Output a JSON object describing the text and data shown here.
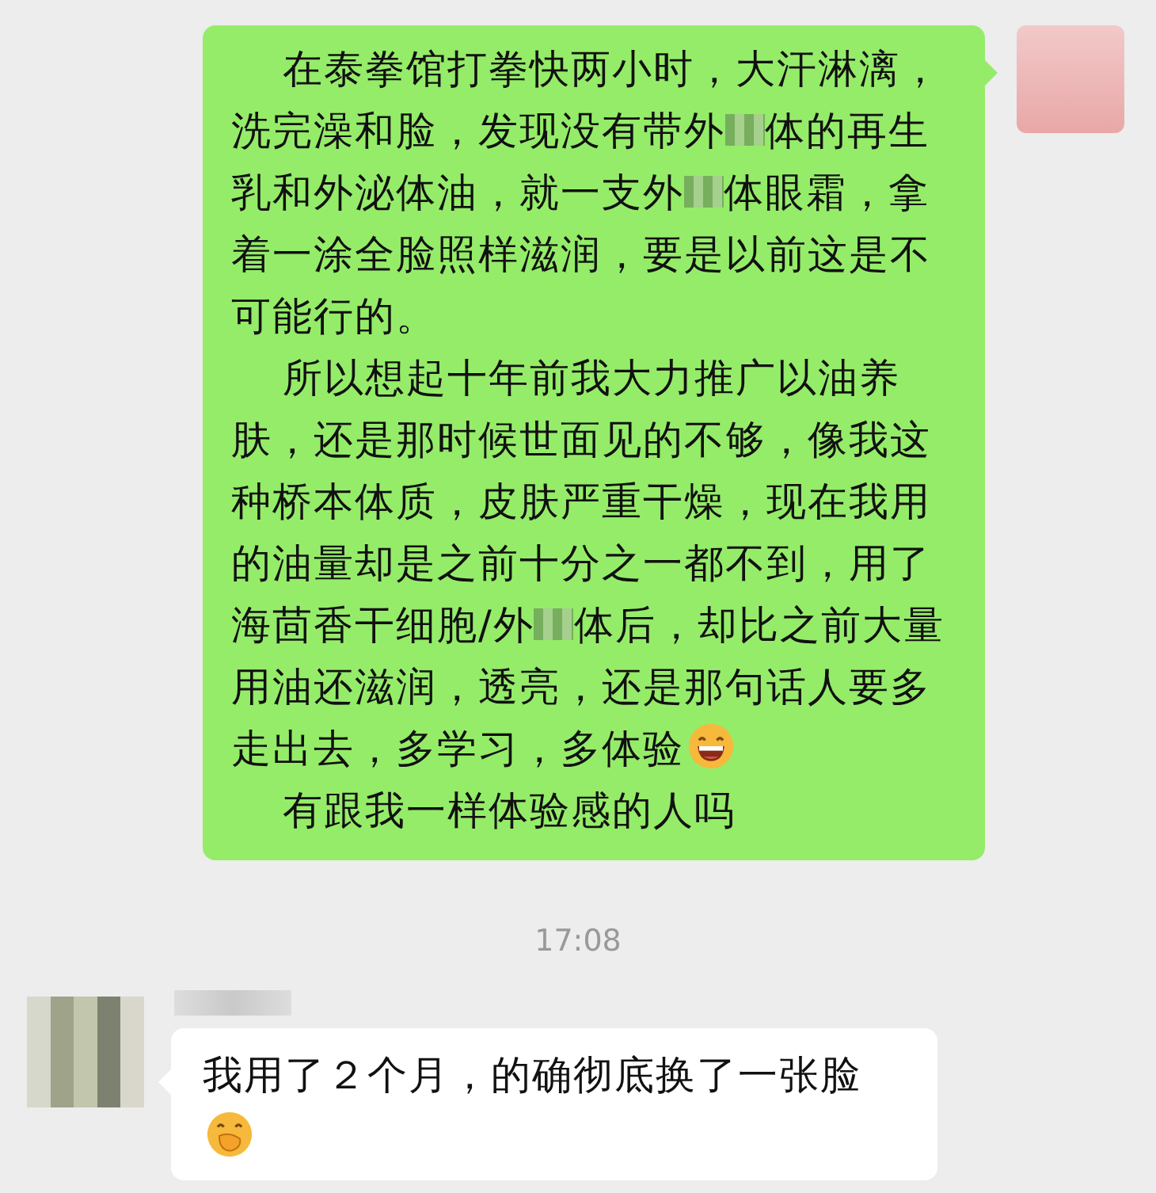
{
  "messages": [
    {
      "kind": "outgoing",
      "paragraphs": [
        [
          {
            "kind": "text",
            "text": "在泰拳馆打拳快两小时，大汗淋漓，洗完澡和脸，发现没有带外"
          },
          {
            "kind": "redacted"
          },
          {
            "kind": "text",
            "text": "体的再生乳和外泌体油，就一支外"
          },
          {
            "kind": "redacted"
          },
          {
            "kind": "text",
            "text": "体眼霜，拿着一涂全脸照样滋润，要是以前这是不可能行的。"
          }
        ],
        [
          {
            "kind": "text",
            "text": "所以想起十年前我大力推广以油养肤，还是那时候世面见的不够，像我这种桥本体质，皮肤严重干燥，现在我用的油量却是之前十分之一都不到，用了海茴香干细胞/外"
          },
          {
            "kind": "redacted"
          },
          {
            "kind": "text",
            "text": "体后，却比之前大量用油还滋润，透亮，还是那句话人要多走出去，多学习，多体验"
          },
          {
            "kind": "emoji"
          }
        ],
        [
          {
            "kind": "text",
            "text": "有跟我一样体验感的人吗"
          }
        ]
      ]
    },
    {
      "kind": "time",
      "text": "17:08"
    },
    {
      "kind": "incoming",
      "paragraphs": [
        [
          {
            "kind": "text",
            "text": "我用了２个月，的确彻底换了一张脸"
          },
          {
            "kind": "emoji"
          }
        ]
      ]
    }
  ]
}
